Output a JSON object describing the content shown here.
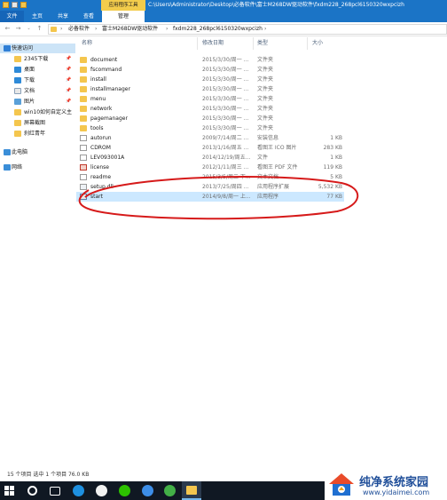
{
  "window": {
    "context_tab": "应用程序工具",
    "path_title": "C:\\Users\\Administrator\\Desktop\\必备软件\\富士M268DW驱动软件\\fxdm228_268pcl6150320wxpcizh"
  },
  "ribbon": {
    "tabs": [
      {
        "label": "文件"
      },
      {
        "label": "主页"
      },
      {
        "label": "共享"
      },
      {
        "label": "查看"
      },
      {
        "label": "管理"
      }
    ]
  },
  "address": {
    "crumbs": [
      "必备软件",
      "富士M268DW驱动软件",
      "fxdm228_268pcl6150320wxpcizh"
    ]
  },
  "nav": {
    "quick_access": "快速访问",
    "items": [
      {
        "label": "2345下载",
        "icon": "folder-icon",
        "pinned": true
      },
      {
        "label": "桌面",
        "icon": "desktop-icon",
        "pinned": true
      },
      {
        "label": "下载",
        "icon": "download-icon",
        "pinned": true
      },
      {
        "label": "文档",
        "icon": "documents-icon",
        "pinned": true
      },
      {
        "label": "图片",
        "icon": "pictures-icon",
        "pinned": true
      },
      {
        "label": "win10如何自定义主",
        "icon": "folder-icon",
        "pinned": false
      },
      {
        "label": "屏幕截图",
        "icon": "folder-icon",
        "pinned": false
      },
      {
        "label": "刹红青年",
        "icon": "folder-icon",
        "pinned": false
      }
    ],
    "this_pc": "此电脑",
    "network": "网络",
    "pin_glyph": "📌"
  },
  "list": {
    "headers": {
      "name": "名称",
      "date": "修改日期",
      "type": "类型",
      "size": "大小"
    },
    "rows": [
      {
        "name": "document",
        "date": "2015/3/30/周一 ...",
        "type": "文件夹",
        "size": "",
        "kind": "folder"
      },
      {
        "name": "fscommand",
        "date": "2015/3/30/周一 ...",
        "type": "文件夹",
        "size": "",
        "kind": "folder"
      },
      {
        "name": "install",
        "date": "2015/3/30/周一 ...",
        "type": "文件夹",
        "size": "",
        "kind": "folder"
      },
      {
        "name": "installmanager",
        "date": "2015/3/30/周一 ...",
        "type": "文件夹",
        "size": "",
        "kind": "folder"
      },
      {
        "name": "menu",
        "date": "2015/3/30/周一 ...",
        "type": "文件夹",
        "size": "",
        "kind": "folder"
      },
      {
        "name": "network",
        "date": "2015/3/30/周一 ...",
        "type": "文件夹",
        "size": "",
        "kind": "folder"
      },
      {
        "name": "pagemanager",
        "date": "2015/3/30/周一 ...",
        "type": "文件夹",
        "size": "",
        "kind": "folder"
      },
      {
        "name": "tools",
        "date": "2015/3/30/周一 ...",
        "type": "文件夹",
        "size": "",
        "kind": "folder"
      },
      {
        "name": "autorun",
        "date": "2009/7/14/周二 ...",
        "type": "安装信息",
        "size": "1 KB",
        "kind": "doc"
      },
      {
        "name": "CDROM",
        "date": "2013/1/16/周五 ...",
        "type": "看图王 ICO 图片",
        "size": "283 KB",
        "kind": "doc"
      },
      {
        "name": "LEV093001A",
        "date": "2014/12/19/周五...",
        "type": "文件",
        "size": "1 KB",
        "kind": "doc"
      },
      {
        "name": "license",
        "date": "2012/1/11/周三 ...",
        "type": "看图王 PDF 文件",
        "size": "119 KB",
        "kind": "doc"
      },
      {
        "name": "readme",
        "date": "2015/3/5/周二 下...",
        "type": "文本文档",
        "size": "5 KB",
        "kind": "doc"
      },
      {
        "name": "setup.dll",
        "date": "2013/7/25/周四 ...",
        "type": "应用程序扩展",
        "size": "5,532 KB",
        "kind": "doc"
      },
      {
        "name": "start",
        "date": "2014/9/8/周一 上...",
        "type": "应用程序",
        "size": "77 KB",
        "kind": "app",
        "selected": true
      }
    ]
  },
  "status": {
    "text": "15 个项目   选中 1 个项目  76.0 KB"
  },
  "watermark": {
    "title": "纯净系统家园",
    "url": "www.yidaimei.com"
  },
  "colors": {
    "titlebar": "#1b74c6",
    "context_tab": "#f3cc4c",
    "selected_row": "#cce8ff",
    "annotation_circle": "#d61a1a",
    "taskbar": "#101823"
  }
}
